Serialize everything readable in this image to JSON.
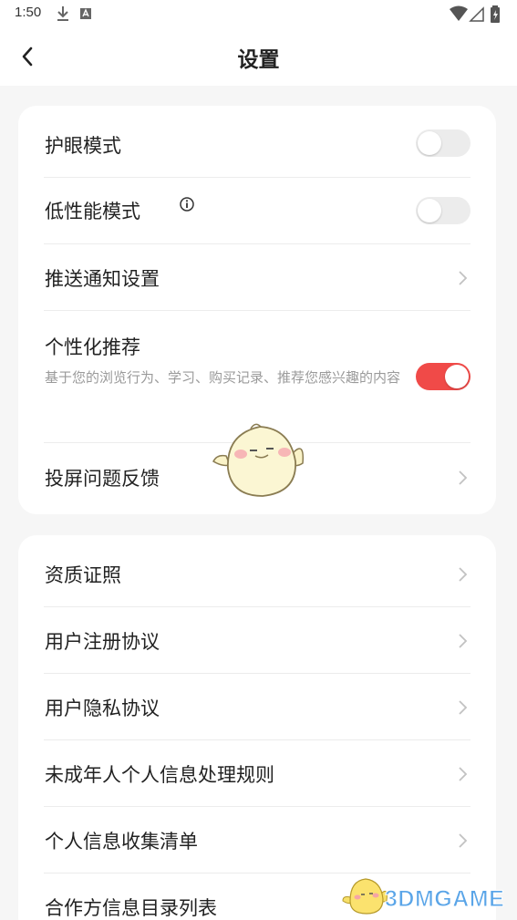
{
  "status_bar": {
    "time": "1:50",
    "icons": [
      "download-icon",
      "font-icon",
      "wifi-icon",
      "signal-icon",
      "battery-icon"
    ]
  },
  "header": {
    "title": "设置",
    "back_icon": "back-arrow-icon"
  },
  "settings_group1": {
    "eye_care": {
      "label": "护眼模式",
      "enabled": false
    },
    "low_performance": {
      "label": "低性能模式",
      "enabled": false,
      "icon": "info-icon"
    },
    "push_settings": {
      "label": "推送通知设置"
    },
    "personalized": {
      "label": "个性化推荐",
      "description": "基于您的浏览行为、学习、购买记录、推荐您感兴趣的内容",
      "enabled": true
    },
    "cast_feedback": {
      "label": "投屏问题反馈"
    }
  },
  "settings_group2": {
    "items": [
      {
        "label": "资质证照"
      },
      {
        "label": "用户注册协议"
      },
      {
        "label": "用户隐私协议"
      },
      {
        "label": "未成年人个人信息处理规则"
      },
      {
        "label": "个人信息收集清单"
      },
      {
        "label": "合作方信息目录列表"
      }
    ]
  },
  "watermark": {
    "text": "3DMGAME"
  },
  "colors": {
    "accent": "#f04a48",
    "toggle_off": "#ececec",
    "background": "#f6f6f6"
  }
}
